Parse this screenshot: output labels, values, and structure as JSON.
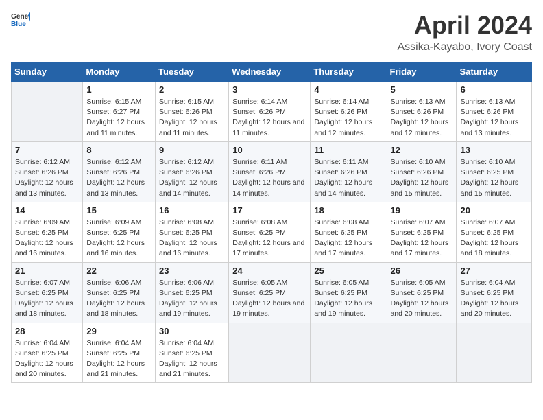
{
  "header": {
    "logo_general": "General",
    "logo_blue": "Blue",
    "title": "April 2024",
    "subtitle": "Assika-Kayabo, Ivory Coast"
  },
  "columns": [
    "Sunday",
    "Monday",
    "Tuesday",
    "Wednesday",
    "Thursday",
    "Friday",
    "Saturday"
  ],
  "weeks": [
    [
      {
        "day": "",
        "sunrise": "",
        "sunset": "",
        "daylight": ""
      },
      {
        "day": "1",
        "sunrise": "Sunrise: 6:15 AM",
        "sunset": "Sunset: 6:27 PM",
        "daylight": "Daylight: 12 hours and 11 minutes."
      },
      {
        "day": "2",
        "sunrise": "Sunrise: 6:15 AM",
        "sunset": "Sunset: 6:26 PM",
        "daylight": "Daylight: 12 hours and 11 minutes."
      },
      {
        "day": "3",
        "sunrise": "Sunrise: 6:14 AM",
        "sunset": "Sunset: 6:26 PM",
        "daylight": "Daylight: 12 hours and 11 minutes."
      },
      {
        "day": "4",
        "sunrise": "Sunrise: 6:14 AM",
        "sunset": "Sunset: 6:26 PM",
        "daylight": "Daylight: 12 hours and 12 minutes."
      },
      {
        "day": "5",
        "sunrise": "Sunrise: 6:13 AM",
        "sunset": "Sunset: 6:26 PM",
        "daylight": "Daylight: 12 hours and 12 minutes."
      },
      {
        "day": "6",
        "sunrise": "Sunrise: 6:13 AM",
        "sunset": "Sunset: 6:26 PM",
        "daylight": "Daylight: 12 hours and 13 minutes."
      }
    ],
    [
      {
        "day": "7",
        "sunrise": "Sunrise: 6:12 AM",
        "sunset": "Sunset: 6:26 PM",
        "daylight": "Daylight: 12 hours and 13 minutes."
      },
      {
        "day": "8",
        "sunrise": "Sunrise: 6:12 AM",
        "sunset": "Sunset: 6:26 PM",
        "daylight": "Daylight: 12 hours and 13 minutes."
      },
      {
        "day": "9",
        "sunrise": "Sunrise: 6:12 AM",
        "sunset": "Sunset: 6:26 PM",
        "daylight": "Daylight: 12 hours and 14 minutes."
      },
      {
        "day": "10",
        "sunrise": "Sunrise: 6:11 AM",
        "sunset": "Sunset: 6:26 PM",
        "daylight": "Daylight: 12 hours and 14 minutes."
      },
      {
        "day": "11",
        "sunrise": "Sunrise: 6:11 AM",
        "sunset": "Sunset: 6:26 PM",
        "daylight": "Daylight: 12 hours and 14 minutes."
      },
      {
        "day": "12",
        "sunrise": "Sunrise: 6:10 AM",
        "sunset": "Sunset: 6:26 PM",
        "daylight": "Daylight: 12 hours and 15 minutes."
      },
      {
        "day": "13",
        "sunrise": "Sunrise: 6:10 AM",
        "sunset": "Sunset: 6:25 PM",
        "daylight": "Daylight: 12 hours and 15 minutes."
      }
    ],
    [
      {
        "day": "14",
        "sunrise": "Sunrise: 6:09 AM",
        "sunset": "Sunset: 6:25 PM",
        "daylight": "Daylight: 12 hours and 16 minutes."
      },
      {
        "day": "15",
        "sunrise": "Sunrise: 6:09 AM",
        "sunset": "Sunset: 6:25 PM",
        "daylight": "Daylight: 12 hours and 16 minutes."
      },
      {
        "day": "16",
        "sunrise": "Sunrise: 6:08 AM",
        "sunset": "Sunset: 6:25 PM",
        "daylight": "Daylight: 12 hours and 16 minutes."
      },
      {
        "day": "17",
        "sunrise": "Sunrise: 6:08 AM",
        "sunset": "Sunset: 6:25 PM",
        "daylight": "Daylight: 12 hours and 17 minutes."
      },
      {
        "day": "18",
        "sunrise": "Sunrise: 6:08 AM",
        "sunset": "Sunset: 6:25 PM",
        "daylight": "Daylight: 12 hours and 17 minutes."
      },
      {
        "day": "19",
        "sunrise": "Sunrise: 6:07 AM",
        "sunset": "Sunset: 6:25 PM",
        "daylight": "Daylight: 12 hours and 17 minutes."
      },
      {
        "day": "20",
        "sunrise": "Sunrise: 6:07 AM",
        "sunset": "Sunset: 6:25 PM",
        "daylight": "Daylight: 12 hours and 18 minutes."
      }
    ],
    [
      {
        "day": "21",
        "sunrise": "Sunrise: 6:07 AM",
        "sunset": "Sunset: 6:25 PM",
        "daylight": "Daylight: 12 hours and 18 minutes."
      },
      {
        "day": "22",
        "sunrise": "Sunrise: 6:06 AM",
        "sunset": "Sunset: 6:25 PM",
        "daylight": "Daylight: 12 hours and 18 minutes."
      },
      {
        "day": "23",
        "sunrise": "Sunrise: 6:06 AM",
        "sunset": "Sunset: 6:25 PM",
        "daylight": "Daylight: 12 hours and 19 minutes."
      },
      {
        "day": "24",
        "sunrise": "Sunrise: 6:05 AM",
        "sunset": "Sunset: 6:25 PM",
        "daylight": "Daylight: 12 hours and 19 minutes."
      },
      {
        "day": "25",
        "sunrise": "Sunrise: 6:05 AM",
        "sunset": "Sunset: 6:25 PM",
        "daylight": "Daylight: 12 hours and 19 minutes."
      },
      {
        "day": "26",
        "sunrise": "Sunrise: 6:05 AM",
        "sunset": "Sunset: 6:25 PM",
        "daylight": "Daylight: 12 hours and 20 minutes."
      },
      {
        "day": "27",
        "sunrise": "Sunrise: 6:04 AM",
        "sunset": "Sunset: 6:25 PM",
        "daylight": "Daylight: 12 hours and 20 minutes."
      }
    ],
    [
      {
        "day": "28",
        "sunrise": "Sunrise: 6:04 AM",
        "sunset": "Sunset: 6:25 PM",
        "daylight": "Daylight: 12 hours and 20 minutes."
      },
      {
        "day": "29",
        "sunrise": "Sunrise: 6:04 AM",
        "sunset": "Sunset: 6:25 PM",
        "daylight": "Daylight: 12 hours and 21 minutes."
      },
      {
        "day": "30",
        "sunrise": "Sunrise: 6:04 AM",
        "sunset": "Sunset: 6:25 PM",
        "daylight": "Daylight: 12 hours and 21 minutes."
      },
      {
        "day": "",
        "sunrise": "",
        "sunset": "",
        "daylight": ""
      },
      {
        "day": "",
        "sunrise": "",
        "sunset": "",
        "daylight": ""
      },
      {
        "day": "",
        "sunrise": "",
        "sunset": "",
        "daylight": ""
      },
      {
        "day": "",
        "sunrise": "",
        "sunset": "",
        "daylight": ""
      }
    ]
  ]
}
